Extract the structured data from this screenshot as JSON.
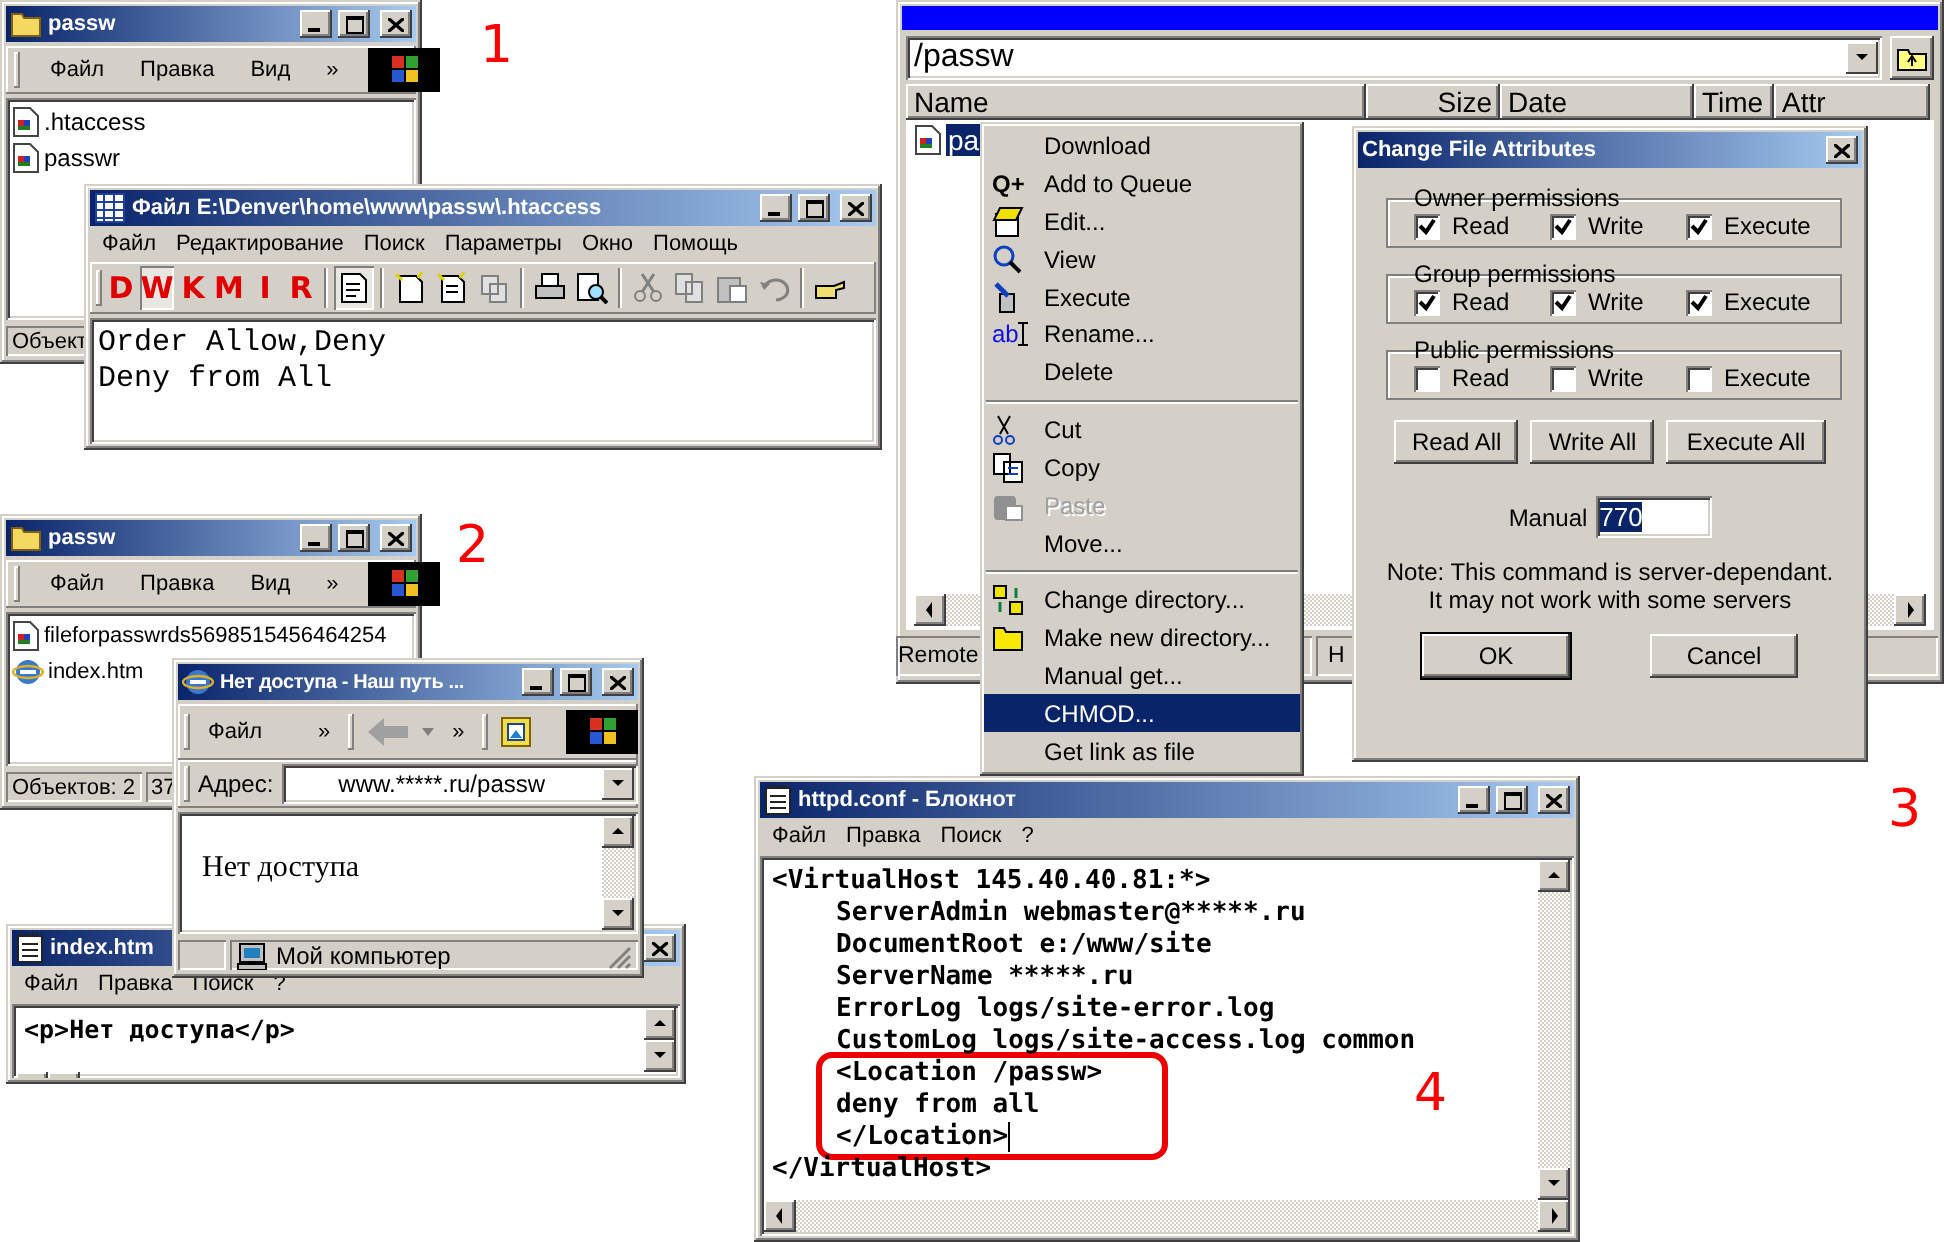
{
  "labels": [
    "1",
    "2",
    "3",
    "4"
  ],
  "explorer_1": {
    "title": "passw",
    "menu": [
      "Файл",
      "Правка",
      "Вид"
    ],
    "chevron": "»",
    "files": [
      {
        "name": ".htaccess",
        "kind": "doc"
      },
      {
        "name": "passwr",
        "kind": "doc"
      }
    ],
    "status": [
      "Объект"
    ]
  },
  "editor": {
    "title": "Файл E:\\Denver\\home\\www\\passw\\.htaccess",
    "menu": [
      "Файл",
      "Редактирование",
      "Поиск",
      "Параметры",
      "Окно",
      "Помощь"
    ],
    "toolbar_letters": [
      {
        "label": "D",
        "selected": false
      },
      {
        "label": "W",
        "selected": true
      },
      {
        "label": "K",
        "selected": false
      },
      {
        "label": "M",
        "selected": false
      },
      {
        "label": "I",
        "selected": false
      },
      {
        "label": "R",
        "selected": false
      }
    ],
    "lines": [
      "Order Allow,Deny",
      "Deny from All"
    ]
  },
  "explorer_2": {
    "title": "passw",
    "menu": [
      "Файл",
      "Правка",
      "Вид"
    ],
    "chevron": "»",
    "files": [
      {
        "name": "fileforpasswrds5698515456464254",
        "kind": "doc"
      },
      {
        "name": "index.htm",
        "kind": "web"
      }
    ],
    "status": [
      "Объектов: 2",
      "37"
    ]
  },
  "notepad_index": {
    "title": "index.htm",
    "menu": [
      "Файл",
      "Правка",
      "Поиск",
      "?"
    ],
    "text": "<p>Нет доступа</p>"
  },
  "browser": {
    "title": "Нет доступа - Наш путь ...",
    "menu": [
      "Файл"
    ],
    "chevrons": [
      "»",
      "»"
    ],
    "address_label": "Адрес:",
    "address": "www.*****.ru/passw",
    "content": "Нет доступа",
    "zone": "Мой компьютер"
  },
  "ftp": {
    "path": "/passw",
    "columns": [
      "Name",
      "Size",
      "Date",
      "Time",
      "Attr"
    ],
    "file": "pa",
    "panels": [
      "Remote",
      "H"
    ]
  },
  "context_menu": {
    "sections": [
      [
        {
          "label": "Download",
          "disabled": false,
          "selected": false
        },
        {
          "label": "Add to Queue",
          "glyph": "Q+",
          "disabled": false,
          "selected": false
        },
        {
          "label": "Edit...",
          "disabled": false,
          "selected": false
        },
        {
          "label": "View",
          "disabled": false,
          "selected": false
        },
        {
          "label": "Execute",
          "disabled": false,
          "selected": false
        },
        {
          "label": "Rename...",
          "glyph": "ab",
          "disabled": false,
          "selected": false
        },
        {
          "label": "Delete",
          "disabled": false,
          "selected": false
        }
      ],
      [
        {
          "label": "Cut",
          "disabled": false,
          "selected": false
        },
        {
          "label": "Copy",
          "disabled": false,
          "selected": false
        },
        {
          "label": "Paste",
          "disabled": true,
          "selected": false
        },
        {
          "label": "Move...",
          "disabled": false,
          "selected": false
        }
      ],
      [
        {
          "label": "Change directory...",
          "disabled": false,
          "selected": false
        },
        {
          "label": "Make new directory...",
          "disabled": false,
          "selected": false
        },
        {
          "label": "Manual get...",
          "disabled": false,
          "selected": false
        },
        {
          "label": "CHMOD...",
          "disabled": false,
          "selected": true
        },
        {
          "label": "Get link as file",
          "disabled": false,
          "selected": false
        }
      ]
    ]
  },
  "chmod_dialog": {
    "title": "Change File Attributes",
    "groups": [
      {
        "title": "Owner permissions",
        "options": [
          {
            "label": "Read",
            "checked": true
          },
          {
            "label": "Write",
            "checked": true
          },
          {
            "label": "Execute",
            "checked": true
          }
        ]
      },
      {
        "title": "Group permissions",
        "options": [
          {
            "label": "Read",
            "checked": true
          },
          {
            "label": "Write",
            "checked": true
          },
          {
            "label": "Execute",
            "checked": true
          }
        ]
      },
      {
        "title": "Public permissions",
        "options": [
          {
            "label": "Read",
            "checked": false
          },
          {
            "label": "Write",
            "checked": false
          },
          {
            "label": "Execute",
            "checked": false
          }
        ]
      }
    ],
    "buttons": [
      "Read All",
      "Write All",
      "Execute All"
    ],
    "manual_label": "Manual",
    "manual_value": "770",
    "note": [
      "Note: This command is server-dependant.",
      "It may not work with some servers"
    ],
    "ok": "OK",
    "cancel": "Cancel"
  },
  "notepad_httpd": {
    "title": "httpd.conf - Блокнот",
    "menu": [
      "Файл",
      "Правка",
      "Поиск",
      "?"
    ],
    "lines": [
      {
        "text": "<VirtualHost 145.40.40.81:*>",
        "indented": false,
        "circled": false,
        "caret": false
      },
      {
        "text": "ServerAdmin webmaster@*****.ru",
        "indented": true,
        "circled": false,
        "caret": false
      },
      {
        "text": "DocumentRoot e:/www/site",
        "indented": true,
        "circled": false,
        "caret": false
      },
      {
        "text": "ServerName *****.ru",
        "indented": true,
        "circled": false,
        "caret": false
      },
      {
        "text": "ErrorLog logs/site-error.log",
        "indented": true,
        "circled": false,
        "caret": false
      },
      {
        "text": "CustomLog logs/site-access.log common",
        "indented": true,
        "circled": false,
        "caret": false
      },
      {
        "text": "<Location /passw>",
        "indented": true,
        "circled": true,
        "caret": false
      },
      {
        "text": "deny from all",
        "indented": true,
        "circled": true,
        "caret": false
      },
      {
        "text": "</Location>",
        "indented": true,
        "circled": true,
        "caret": true
      },
      {
        "text": "</VirtualHost>",
        "indented": false,
        "circled": false,
        "caret": false
      }
    ]
  }
}
